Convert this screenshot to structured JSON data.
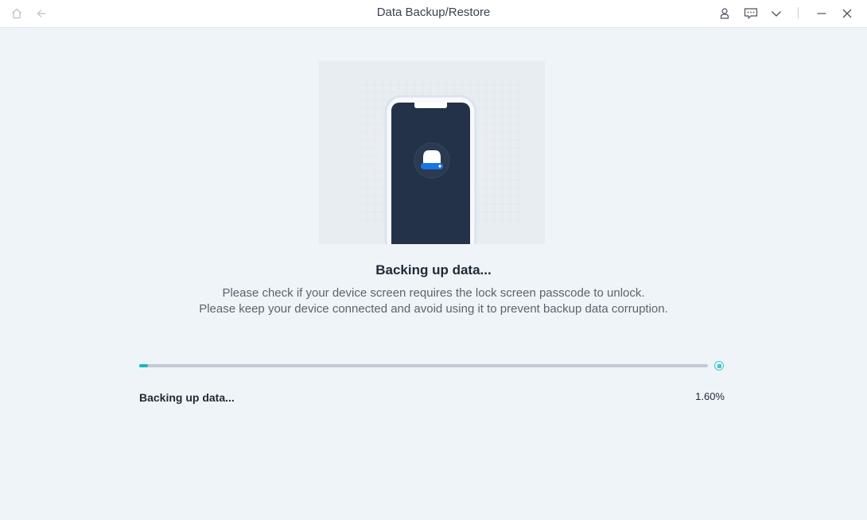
{
  "window": {
    "title": "Data Backup/Restore"
  },
  "titlebar": {
    "left_icons": [
      "home-icon",
      "back-arrow-icon"
    ],
    "right_icons": [
      "user-icon",
      "feedback-icon",
      "chevron-down-icon",
      "minimize-icon",
      "close-icon"
    ]
  },
  "illustration": {
    "icon": "drive-icon"
  },
  "main": {
    "heading": "Backing up data...",
    "description_line1": "Please check if your device screen requires the lock screen passcode to unlock.",
    "description_line2": "Please keep your device connected and avoid using it to prevent backup data corruption."
  },
  "progress": {
    "label": "Backing up data...",
    "percent_text": "1.60%",
    "value": 0.016
  },
  "colors": {
    "accent": "#16b8c2",
    "track": "#c2cad4",
    "background": "#eff4f8",
    "phone": "#233248",
    "drive_stripe": "#1a73e8"
  }
}
